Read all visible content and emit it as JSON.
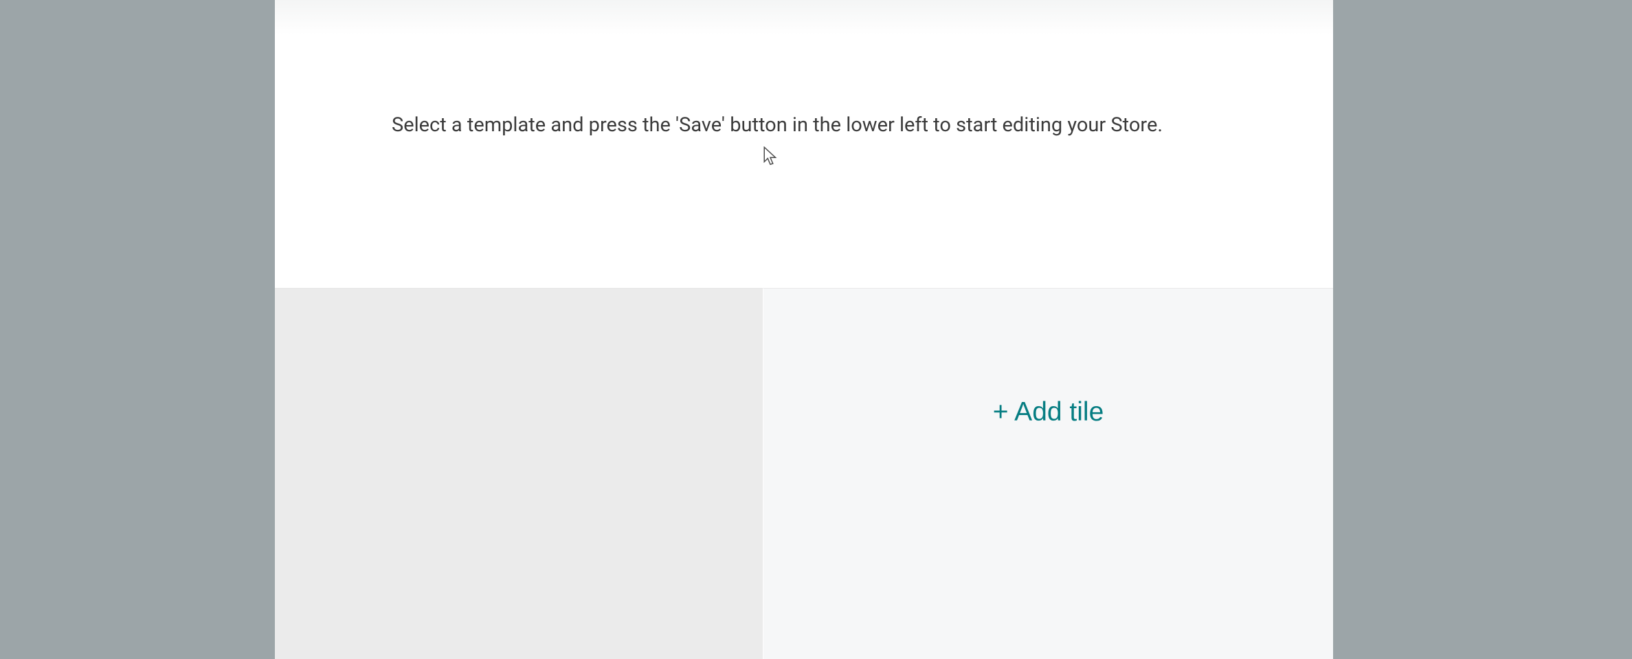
{
  "instruction": "Select a template and press the 'Save' button in the lower left to start editing your Store.",
  "tiles": {
    "add_tile_label": "+ Add tile"
  }
}
